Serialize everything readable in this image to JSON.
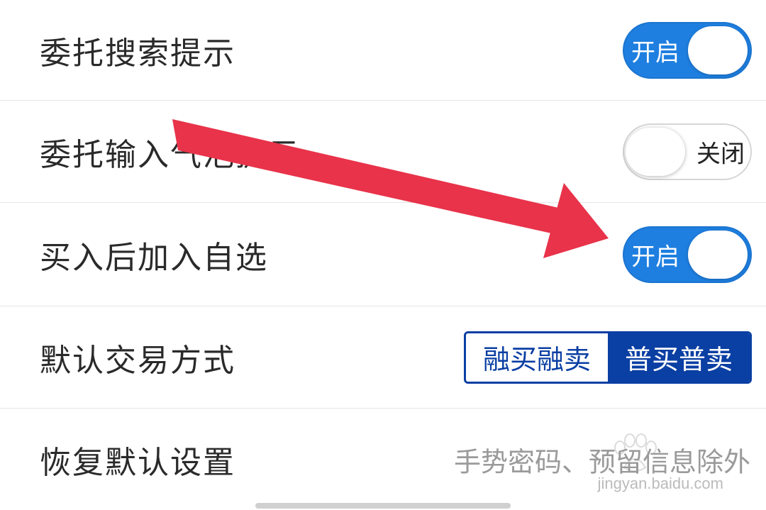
{
  "settings": {
    "rows": [
      {
        "label": "委托搜索提示",
        "control": "toggle",
        "state": "on",
        "state_label": "开启"
      },
      {
        "label": "委托输入气泡提示",
        "control": "toggle",
        "state": "off",
        "state_label": "关闭"
      },
      {
        "label": "买入后加入自选",
        "control": "toggle",
        "state": "on",
        "state_label": "开启"
      },
      {
        "label": "默认交易方式",
        "control": "segmented",
        "options": [
          "融买融卖",
          "普买普卖"
        ],
        "selected": "普买普卖"
      },
      {
        "label": "恢复默认设置",
        "control": "text",
        "value": "手势密码、预留信息除外"
      }
    ]
  },
  "annotation": {
    "arrow_color": "#e8334a"
  },
  "colors": {
    "toggle_on": "#1e7fe0",
    "segment_selected": "#0a3fa3"
  },
  "watermark": {
    "text": "jingyan.baidu.com"
  }
}
